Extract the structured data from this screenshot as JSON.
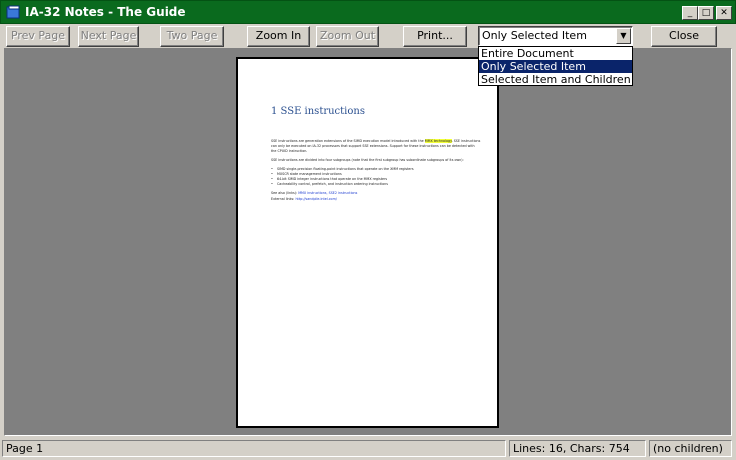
{
  "window": {
    "title": "IA-32 Notes - The Guide",
    "minimize": "_",
    "maximize": "□",
    "close": "✕"
  },
  "toolbar": {
    "prev_page": "Prev Page",
    "next_page": "Next Page",
    "two_page": "Two Page",
    "zoom_in": "Zoom In",
    "zoom_out": "Zoom Out",
    "print": "Print...",
    "close": "Close"
  },
  "print_scope": {
    "selected": "Only Selected Item",
    "options": [
      "Entire Document",
      "Only Selected Item",
      "Selected Item and Children"
    ]
  },
  "document": {
    "title": "1 SSE instructions",
    "para1_a": "SSE instructions are generation extensions of the SIMD execution model introduced with the ",
    "para1_hl": "MMX technology",
    "para1_b": ". SSE instructions can only be executed on IA-32 processors that support SSE extensions. Support for these instructions can be detected with the CPUID instruction.",
    "para2": "SSE instructions are divided into four subgroups (note that the first subgroup has subordinate subgroups of its own):",
    "bullets": [
      "SIMD single-precision floating-point instructions that operate on the XMM registers",
      "MXSCR state management instructions",
      "64-bit SIMD integer instructions that operate on the MMX registers",
      "Cacheability control, prefetch, and instruction ordering instructions"
    ],
    "see_also_label": "See also (links): ",
    "see_also_links": "MMX instructions, SSE2 instructions",
    "external_label": "External links: ",
    "external_link": "http://sandpile.intel.com/"
  },
  "status": {
    "page": "Page 1",
    "counts": "Lines: 16, Chars: 754",
    "children": "(no children)"
  }
}
